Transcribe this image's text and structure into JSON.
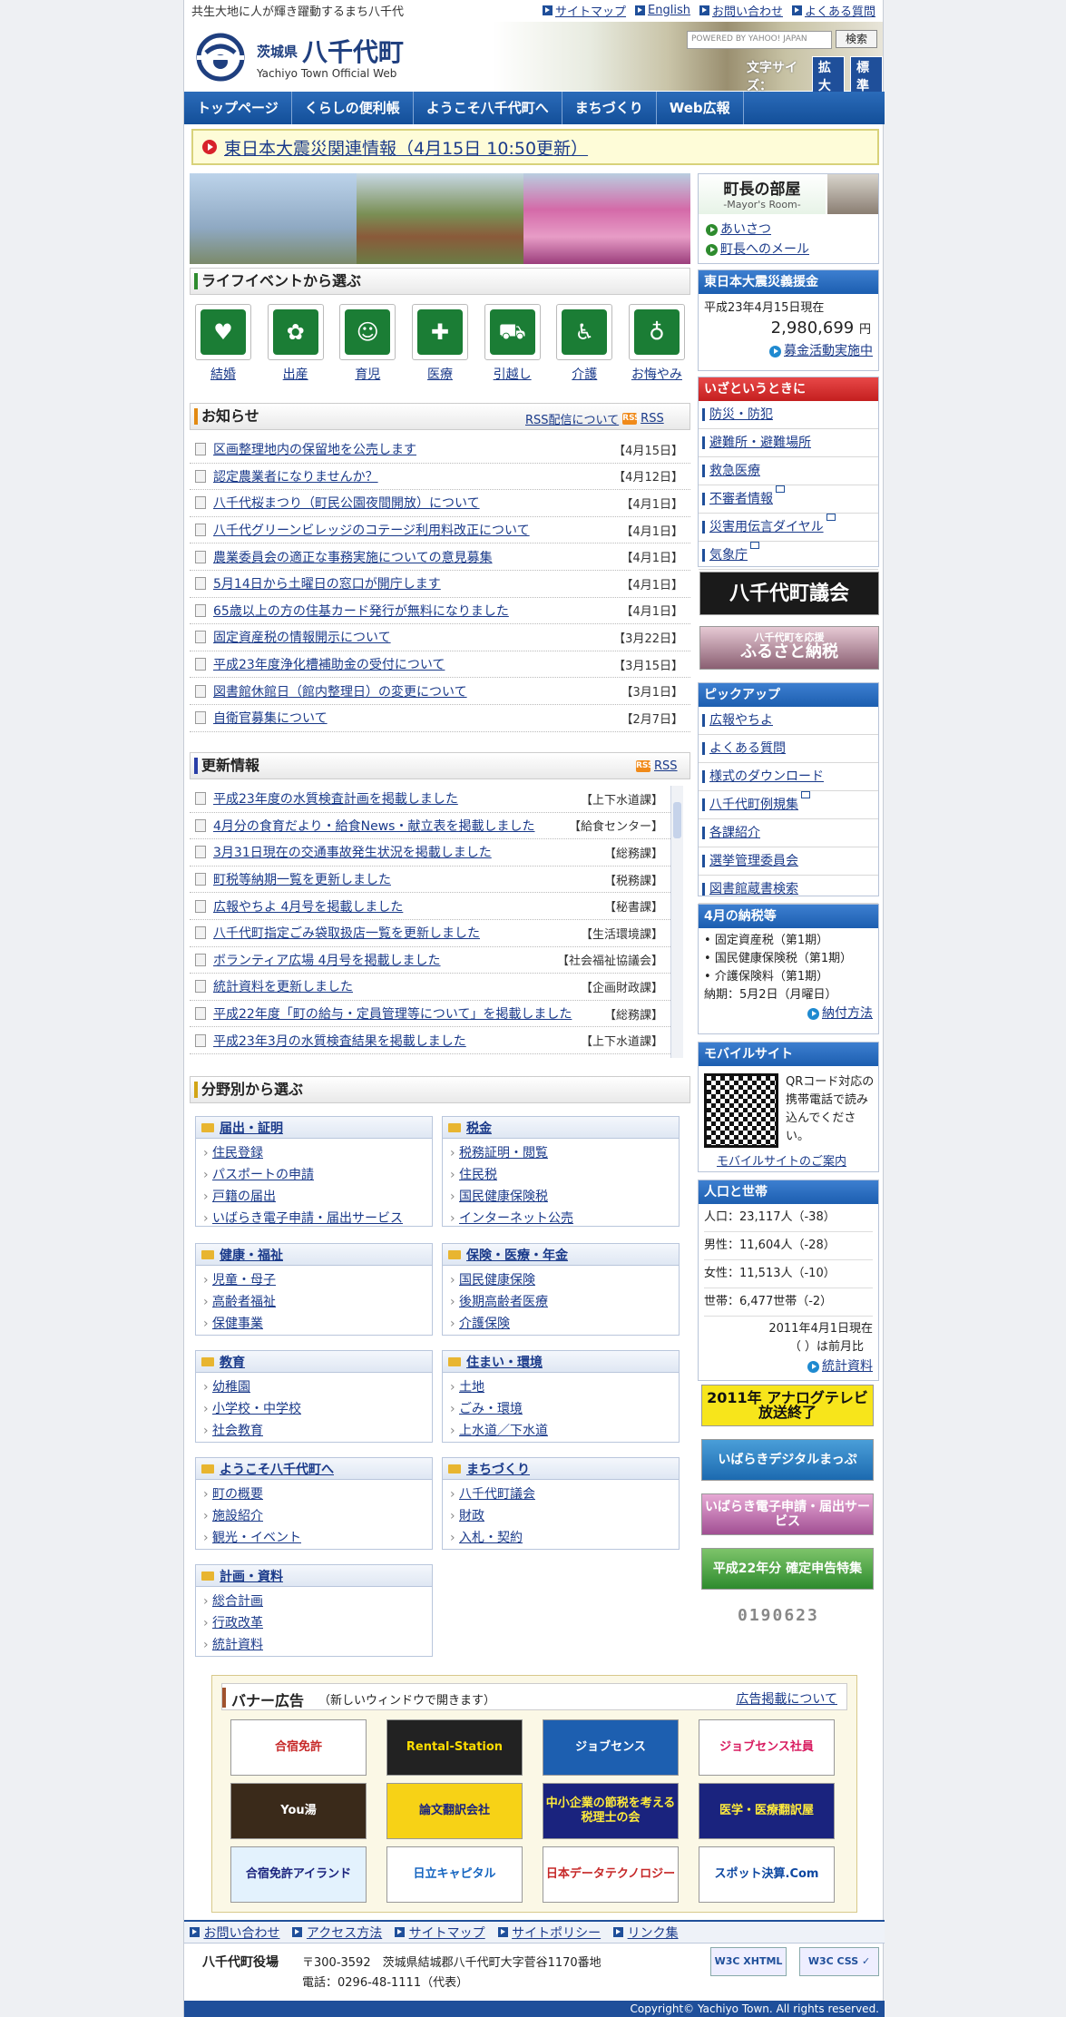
{
  "header": {
    "tagline": "共生大地に人が輝き躍動するまち八千代",
    "toplinks": [
      "サイトマップ",
      "English",
      "お問い合わせ",
      "よくある質問"
    ],
    "logo_pref": "茨城県",
    "logo_town": "八千代町",
    "logo_en": "Yachiyo Town Official Web",
    "search_placeholder": "POWERED BY YAHOO! JAPAN",
    "search_button": "検索",
    "fontsize_label": "文字サイズ：",
    "fontsize_large": "拡大",
    "fontsize_std": "標準"
  },
  "nav": [
    "トップページ",
    "くらしの便利帳",
    "ようこそ八千代町へ",
    "まちづくり",
    "Web広報"
  ],
  "quake_notice": "東日本大震災関連情報（4月15日 10:50更新）",
  "life": {
    "title": "ライフイベントから選ぶ",
    "items": [
      "結婚",
      "出産",
      "育児",
      "医療",
      "引越し",
      "介護",
      "お悔やみ"
    ]
  },
  "news": {
    "title": "お知らせ",
    "rss_about": "RSS配信について",
    "rss": "RSS",
    "items": [
      {
        "t": "区画整理地内の保留地を公売します",
        "d": "【4月15日】"
      },
      {
        "t": "認定農業者になりませんか？",
        "d": "【4月12日】"
      },
      {
        "t": "八千代桜まつり（町民公園夜間開放）について",
        "d": "【4月1日】"
      },
      {
        "t": "八千代グリーンビレッジのコテージ利用料改正について",
        "d": "【4月1日】"
      },
      {
        "t": "農業委員会の適正な事務実施についての意見募集",
        "d": "【4月1日】"
      },
      {
        "t": "5月14日から土曜日の窓口が開庁します",
        "d": "【4月1日】"
      },
      {
        "t": "65歳以上の方の住基カード発行が無料になりました",
        "d": "【4月1日】"
      },
      {
        "t": "固定資産税の情報開示について",
        "d": "【3月22日】"
      },
      {
        "t": "平成23年度浄化槽補助金の受付について",
        "d": "【3月15日】"
      },
      {
        "t": "図書館休館日（館内整理日）の変更について",
        "d": "【3月1日】"
      },
      {
        "t": "自衛官募集について",
        "d": "【2月7日】"
      }
    ]
  },
  "updates": {
    "title": "更新情報",
    "rss": "RSS",
    "items": [
      {
        "t": "平成23年度の水質検査計画を掲載しました",
        "d": "【上下水道課】"
      },
      {
        "t": "4月分の食育だより・給食News・献立表を掲載しました",
        "d": "【給食センター】"
      },
      {
        "t": "3月31日現在の交通事故発生状況を掲載しました",
        "d": "【総務課】"
      },
      {
        "t": "町税等納期一覧を更新しました",
        "d": "【税務課】"
      },
      {
        "t": "広報やちよ 4月号を掲載しました",
        "d": "【秘書課】"
      },
      {
        "t": "八千代町指定ごみ袋取扱店一覧を更新しました",
        "d": "【生活環境課】"
      },
      {
        "t": "ボランティア広場 4月号を掲載しました",
        "d": "【社会福祉協議会】"
      },
      {
        "t": "統計資料を更新しました",
        "d": "【企画財政課】"
      },
      {
        "t": "平成22年度「町の給与・定員管理等について」を掲載しました",
        "d": "【総務課】"
      },
      {
        "t": "平成23年3月の水質検査結果を掲載しました",
        "d": "【上下水道課】"
      }
    ]
  },
  "categories": {
    "title": "分野別から選ぶ",
    "groups": [
      {
        "h": "届出・証明",
        "items": [
          "住民登録",
          "パスポートの申請",
          "戸籍の届出",
          "いばらき電子申請・届出サービス"
        ]
      },
      {
        "h": "税金",
        "items": [
          "税務証明・閲覧",
          "住民税",
          "国民健康保険税",
          "インターネット公売"
        ]
      },
      {
        "h": "健康・福祉",
        "items": [
          "児童・母子",
          "高齢者福祉",
          "保健事業"
        ]
      },
      {
        "h": "保険・医療・年金",
        "items": [
          "国民健康保険",
          "後期高齢者医療",
          "介護保険"
        ]
      },
      {
        "h": "教育",
        "items": [
          "幼稚園",
          "小学校・中学校",
          "社会教育"
        ]
      },
      {
        "h": "住まい・環境",
        "items": [
          "土地",
          "ごみ・環境",
          "上水道／下水道"
        ]
      },
      {
        "h": "ようこそ八千代町へ",
        "items": [
          "町の概要",
          "施設紹介",
          "観光・イベント"
        ]
      },
      {
        "h": "まちづくり",
        "items": [
          "八千代町議会",
          "財政",
          "入札・契約"
        ]
      },
      {
        "h": "計画・資料",
        "items": [
          "総合計画",
          "行政改革",
          "統計資料"
        ]
      }
    ]
  },
  "mayor": {
    "title": "町長の部屋",
    "sub": "-Mayor's Room-",
    "links": [
      "あいさつ",
      "町長へのメール"
    ]
  },
  "donation": {
    "title": "東日本大震災義援金",
    "date": "平成23年4月15日現在",
    "amount": "2,980,699",
    "unit": "円",
    "link": "募金活動実施中"
  },
  "emergency": {
    "title": "いざというときに",
    "items": [
      "防災・防犯",
      "避難所・避難場所",
      "救急医療",
      "不審者情報",
      "災害用伝言ダイヤル",
      "気象庁"
    ]
  },
  "side_banners": {
    "council": "八千代町議会",
    "furusato_top": "八千代町を応援",
    "furusato": "ふるさと納税"
  },
  "pickup": {
    "title": "ピックアップ",
    "items": [
      "広報やちよ",
      "よくある質問",
      "様式のダウンロード",
      "八千代町例規集",
      "各課紹介",
      "選挙管理委員会",
      "図書館蔵書検索"
    ]
  },
  "tax": {
    "title": "4月の納税等",
    "items": [
      "固定資産税（第1期）",
      "国民健康保険税（第1期）",
      "介護保険料（第1期）"
    ],
    "due": "納期：5月2日（月曜日）",
    "link": "納付方法"
  },
  "mobile": {
    "title": "モバイルサイト",
    "text": "QRコード対応の携帯電話で読み込んでください。",
    "link": "モバイルサイトのご案内"
  },
  "population": {
    "title": "人口と世帯",
    "rows": [
      "人口：23,117人（-38）",
      "男性：11,604人（-28）",
      "女性：11,513人（-10）",
      "世帯：6,477世帯（-2）"
    ],
    "date": "2011年4月1日現在",
    "note": "（ ）は前月比",
    "link": "統計資料"
  },
  "small_banners": [
    "2011年 アナログテレビ放送終了",
    "いばらきデジタルまっぷ",
    "いばらき電子申請・届出サービス",
    "平成22年分 確定申告特集"
  ],
  "counter": "0190623",
  "ads": {
    "title": "バナー広告",
    "note": "（新しいウィンドウで開きます）",
    "link": "広告掲載について",
    "items": [
      "合宿免許",
      "Rental-Station",
      "ジョブセンス",
      "ジョブセンス社員",
      "You湯",
      "論文翻訳会社",
      "中小企業の節税を考える税理士の会",
      "医学・医療翻訳屋",
      "合宿免許アイランド",
      "日立キャピタル",
      "日本データテクノロジー",
      "スポット決算.Com"
    ]
  },
  "footer": {
    "links": [
      "お問い合わせ",
      "アクセス方法",
      "サイトマップ",
      "サイトポリシー",
      "リンク集"
    ],
    "office": "八千代町役場",
    "address": "〒300-3592　茨城県結城郡八千代町大字菅谷1170番地",
    "tel": "電話：0296-48-1111（代表）",
    "copyright": "Copyright© Yachiyo Town. All rights reserved."
  }
}
